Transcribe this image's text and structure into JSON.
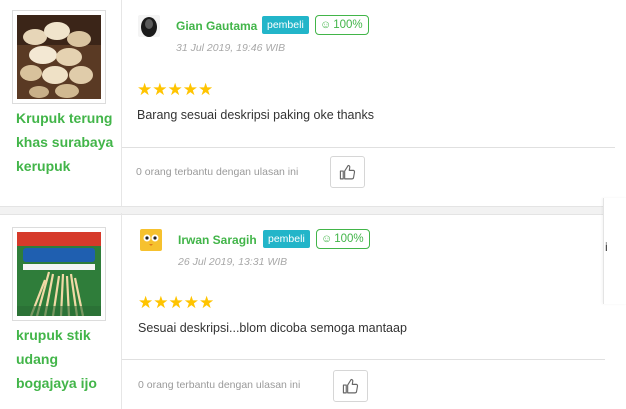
{
  "reviews": [
    {
      "product_name": "Krupuk terung khas surabaya kerupuk",
      "user_name": "Gian Gautama",
      "badge": "pembeli",
      "score": "100%",
      "date": "31 Jul 2019, 19:46 WIB",
      "rating": 5,
      "stars": "★★★★★",
      "text": "Barang sesuai deskripsi paking oke thanks",
      "helpful_text": "0 orang terbantu dengan ulasan ini"
    },
    {
      "product_name": "krupuk stik udang bogajaya ijo",
      "user_name": "Irwan Saragih",
      "badge": "pembeli",
      "score": "100%",
      "date": "26 Jul 2019, 13:31 WIB",
      "rating": 5,
      "stars": "★★★★★",
      "text": "Sesuai deskripsi...blom dicoba semoga mantaap",
      "helpful_text": "0 orang terbantu dengan ulasan ini"
    }
  ],
  "side_char": "i",
  "colors": {
    "green": "#42b549",
    "badge": "#22b5c9",
    "star": "#ffc400"
  },
  "icons": {
    "like": "thumbs-up-icon",
    "score": "smiley-icon"
  }
}
